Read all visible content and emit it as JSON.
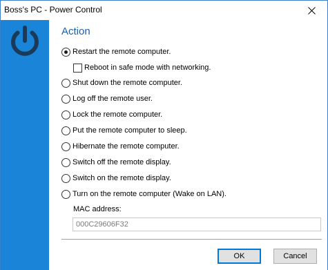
{
  "window": {
    "title": "Boss's PC - Power Control",
    "close_glyph": "✕"
  },
  "sidebar": {
    "icon": "power-icon",
    "color": "#1a84d8"
  },
  "main": {
    "heading": "Action",
    "options": {
      "restart": {
        "label": "Restart the remote computer.",
        "checked": true
      },
      "safe_mode": {
        "label": "Reboot in safe mode with networking.",
        "checked": false
      },
      "shutdown": {
        "label": "Shut down the remote computer.",
        "checked": false
      },
      "logoff": {
        "label": "Log off the remote user.",
        "checked": false
      },
      "lock": {
        "label": "Lock the remote computer.",
        "checked": false
      },
      "sleep": {
        "label": "Put the remote computer to sleep.",
        "checked": false
      },
      "hibernate": {
        "label": "Hibernate the remote computer.",
        "checked": false
      },
      "display_off": {
        "label": "Switch off the remote display.",
        "checked": false
      },
      "display_on": {
        "label": "Switch on the remote display.",
        "checked": false
      },
      "wake_on_lan": {
        "label": "Turn on the remote computer (Wake on LAN).",
        "checked": false
      }
    },
    "mac_label": "MAC address:",
    "mac_value": "000C29606F32"
  },
  "buttons": {
    "ok": "OK",
    "cancel": "Cancel"
  },
  "colors": {
    "accent": "#1a84d8",
    "heading": "#1f5ea8",
    "default_button_border": "#0078d7"
  }
}
